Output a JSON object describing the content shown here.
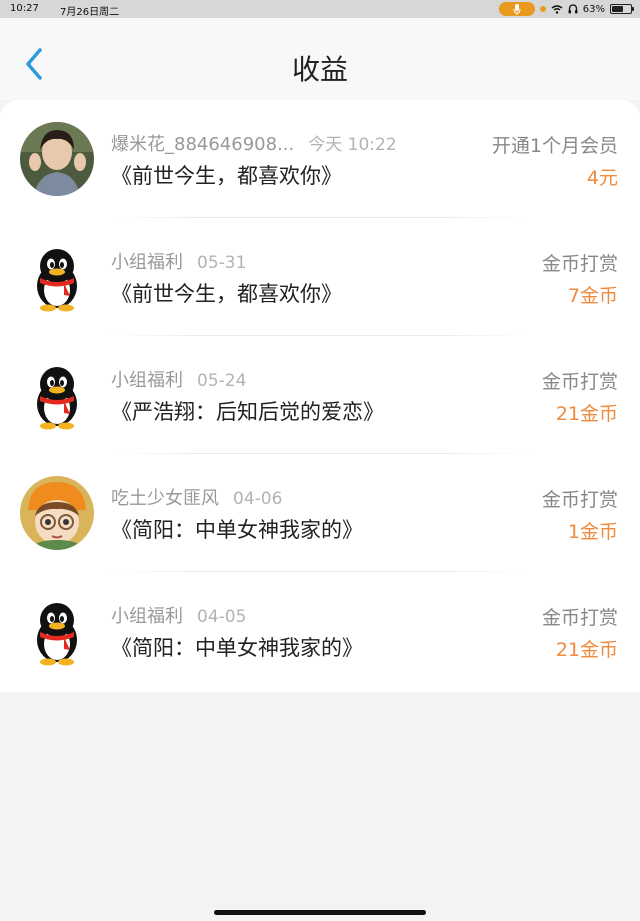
{
  "status_bar": {
    "time": "10:27",
    "date": "7月26日周二",
    "battery": "63%",
    "battery_level": 0.63
  },
  "header": {
    "title": "收益",
    "back_icon": "chevron-left-icon",
    "accent": "#2f9bdb"
  },
  "entries": [
    {
      "avatar": "photo-avatar",
      "source": "爆米花_884646908...",
      "date": "今天 10:22",
      "work": "《前世今生，都喜欢你》",
      "type": "开通1个月会员",
      "amount": "4元"
    },
    {
      "avatar": "qq-penguin-icon",
      "source": "小组福利",
      "date": "05-31",
      "work": "《前世今生，都喜欢你》",
      "type": "金币打赏",
      "amount": "7金币"
    },
    {
      "avatar": "qq-penguin-icon",
      "source": "小组福利",
      "date": "05-24",
      "work": "《严浩翔：后知后觉的爱恋》",
      "type": "金币打赏",
      "amount": "21金币"
    },
    {
      "avatar": "cartoon-girl-avatar",
      "source": "吃土少女匪风",
      "date": "04-06",
      "work": "《简阳：中单女神我家的》",
      "type": "金币打赏",
      "amount": "1金币"
    },
    {
      "avatar": "qq-penguin-icon",
      "source": "小组福利",
      "date": "04-05",
      "work": "《简阳：中单女神我家的》",
      "type": "金币打赏",
      "amount": "21金币"
    }
  ],
  "colors": {
    "amount": "#f08a3c",
    "meta": "#999999",
    "background": "#f3f3f3"
  }
}
